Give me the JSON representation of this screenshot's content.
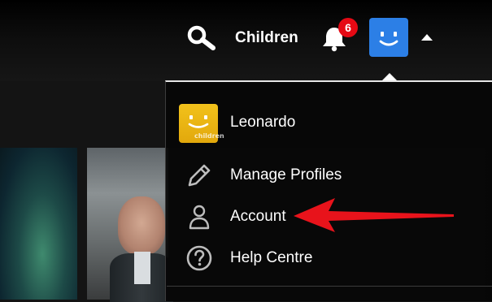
{
  "header": {
    "profile_name": "Children",
    "notification_count": "6",
    "avatar_color": "#2c7fe6"
  },
  "menu": {
    "profile": {
      "name": "Leonardo",
      "avatar_color": "#f0bb18",
      "avatar_tag": "children"
    },
    "items": [
      {
        "label": "Manage Profiles",
        "icon": "pencil-icon"
      },
      {
        "label": "Account",
        "icon": "person-icon"
      },
      {
        "label": "Help Centre",
        "icon": "help-icon"
      }
    ]
  },
  "colors": {
    "badge": "#e50914",
    "annotation_arrow": "#e8131b"
  }
}
